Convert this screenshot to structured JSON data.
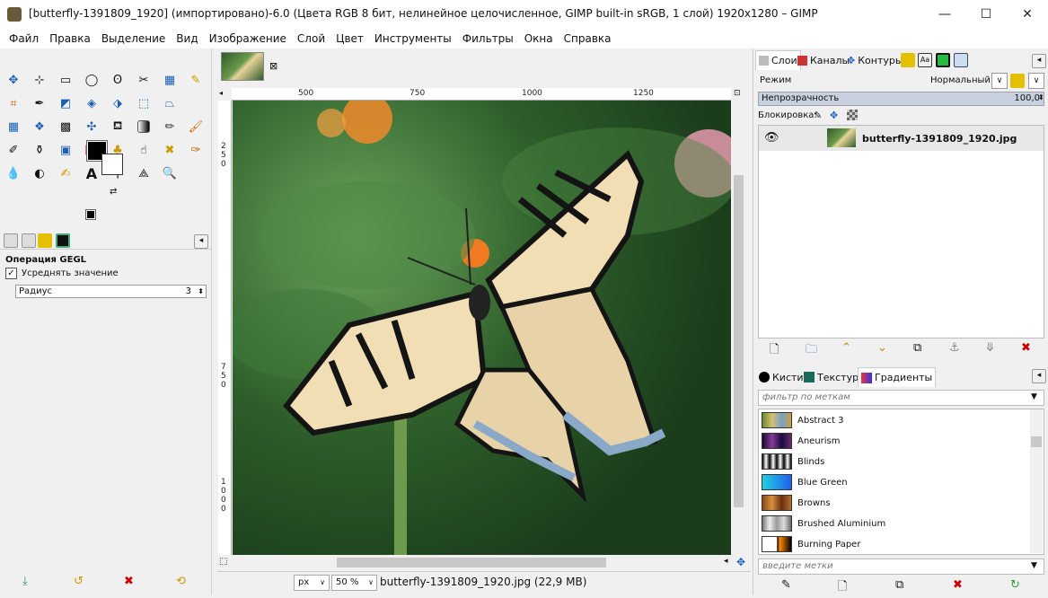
{
  "window": {
    "title": "[butterfly-1391809_1920] (импортировано)-6.0 (Цвета RGB 8 бит, нелинейное целочисленное, GIMP built-in sRGB, 1 слой) 1920x1280 – GIMP",
    "minimize": "—",
    "maximize": "☐",
    "close": "✕"
  },
  "menu": [
    "Файл",
    "Правка",
    "Выделение",
    "Вид",
    "Изображение",
    "Слой",
    "Цвет",
    "Инструменты",
    "Фильтры",
    "Окна",
    "Справка"
  ],
  "tool_options": {
    "title": "Операция GEGL",
    "average_label": "Усреднять значение",
    "average_checked": "✓",
    "radius_label": "Радиус",
    "radius_value": "3"
  },
  "ruler": {
    "h": [
      "500",
      "750",
      "1000",
      "1250"
    ],
    "v": [
      "2",
      "5",
      "0",
      "7",
      "5",
      "0",
      "1",
      "0",
      "0",
      "0"
    ]
  },
  "status": {
    "unit": "px",
    "zoom": "50 %",
    "text": "butterfly-1391809_1920.jpg (22,9 MB)"
  },
  "layers_panel": {
    "tabs": [
      "Слои",
      "Каналы",
      "Контуры"
    ],
    "mode_label": "Режим",
    "mode_value": "Нормальный",
    "opacity_label": "Непрозрачность",
    "opacity_value": "100,0",
    "lock_label": "Блокировка:",
    "layer_name": "butterfly-1391809_1920.jpg"
  },
  "resources_panel": {
    "tabs": [
      "Кисти",
      "Текстуры",
      "Градиенты"
    ],
    "filter_placeholder": "фильтр по меткам",
    "tags_placeholder": "введите метки",
    "gradients": [
      "Abstract 3",
      "Aneurism",
      "Blinds",
      "Blue Green",
      "Browns",
      "Brushed Aluminium",
      "Burning Paper"
    ]
  },
  "colors": {
    "accent": "#c8d0e0",
    "foreground": "#000000",
    "background": "#ffffff"
  }
}
